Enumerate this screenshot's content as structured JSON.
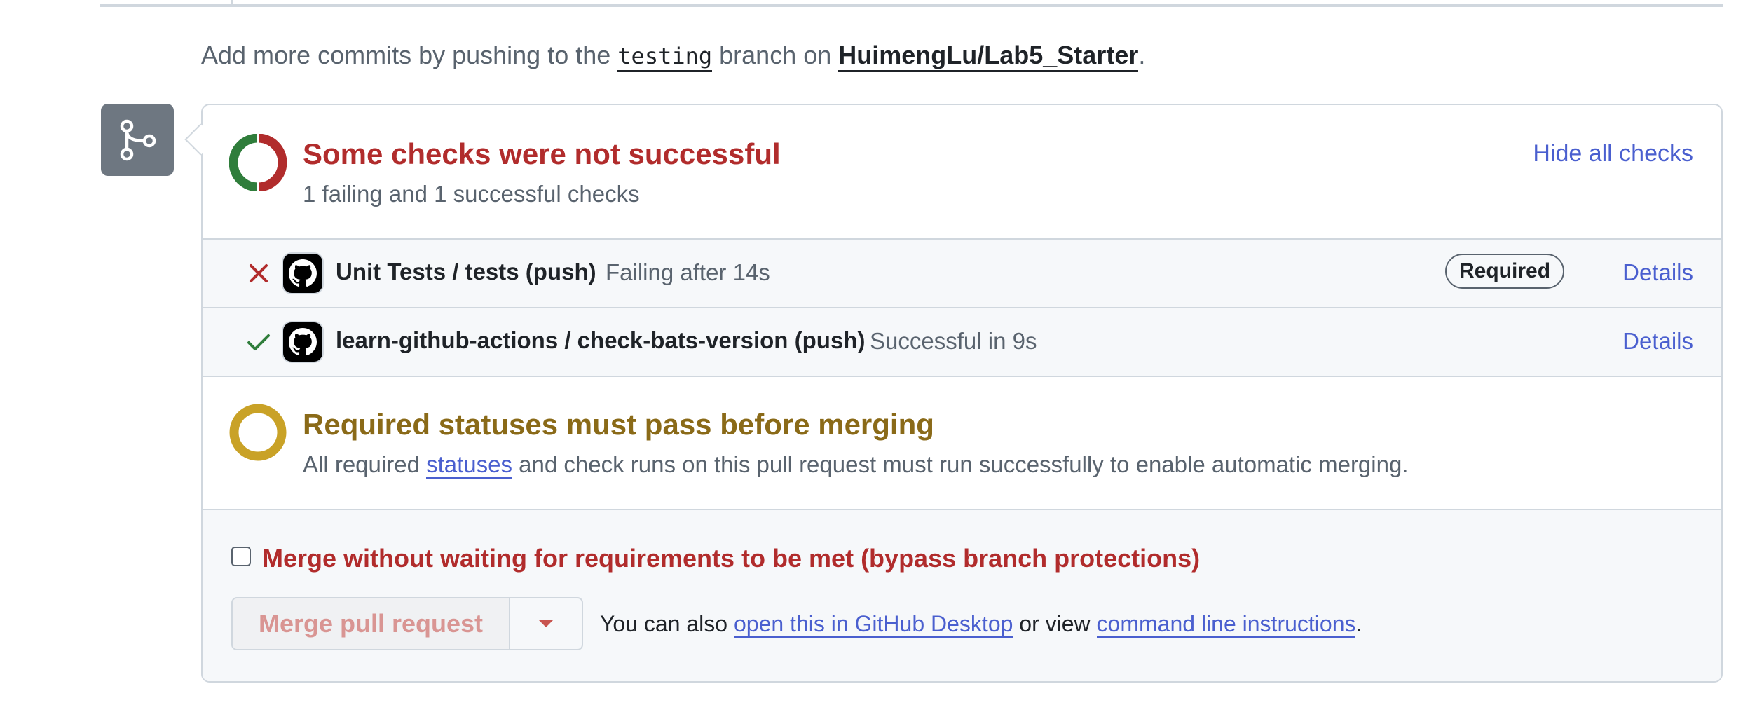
{
  "hint": {
    "prefix": "Add more commits by pushing to the ",
    "branch": "testing",
    "middle": " branch on ",
    "repo": "HuimengLu/Lab5_Starter",
    "suffix": "."
  },
  "checks": {
    "title": "Some checks were not successful",
    "subtitle": "1 failing and 1 successful checks",
    "hide_link": "Hide all checks",
    "items": [
      {
        "status": "failure",
        "name": "Unit Tests / tests (push)",
        "desc": "Failing after 14s",
        "badge": "Required",
        "details": "Details"
      },
      {
        "status": "success",
        "name": "learn-github-actions / check-bats-version (push)",
        "desc": "Successful in 9s",
        "details": "Details"
      }
    ]
  },
  "required": {
    "title": "Required statuses must pass before merging",
    "desc_prefix": "All required ",
    "desc_link": "statuses",
    "desc_suffix": " and check runs on this pull request must run successfully to enable automatic merging."
  },
  "merge": {
    "bypass_label": "Merge without waiting for requirements to be met (bypass branch protections)",
    "bypass_checked": false,
    "button_label": "Merge pull request",
    "also_prefix": "You can also ",
    "desktop_link": "open this in GitHub Desktop",
    "also_middle": " or view ",
    "cli_link": "command line instructions",
    "also_suffix": "."
  },
  "colors": {
    "failure": "#b12c2c",
    "success": "#2f7d3b",
    "pending": "#c9a227",
    "link": "#4a5fcf",
    "icon_bg": "#6e7781"
  },
  "icons": {
    "merge_sidebar": "git-merge-icon",
    "donut": "checks-status-donut-icon",
    "failure": "x-icon",
    "success": "check-icon",
    "app_avatar": "github-icon",
    "pending": "pending-ring-icon",
    "dropdown": "triangle-down-icon"
  }
}
